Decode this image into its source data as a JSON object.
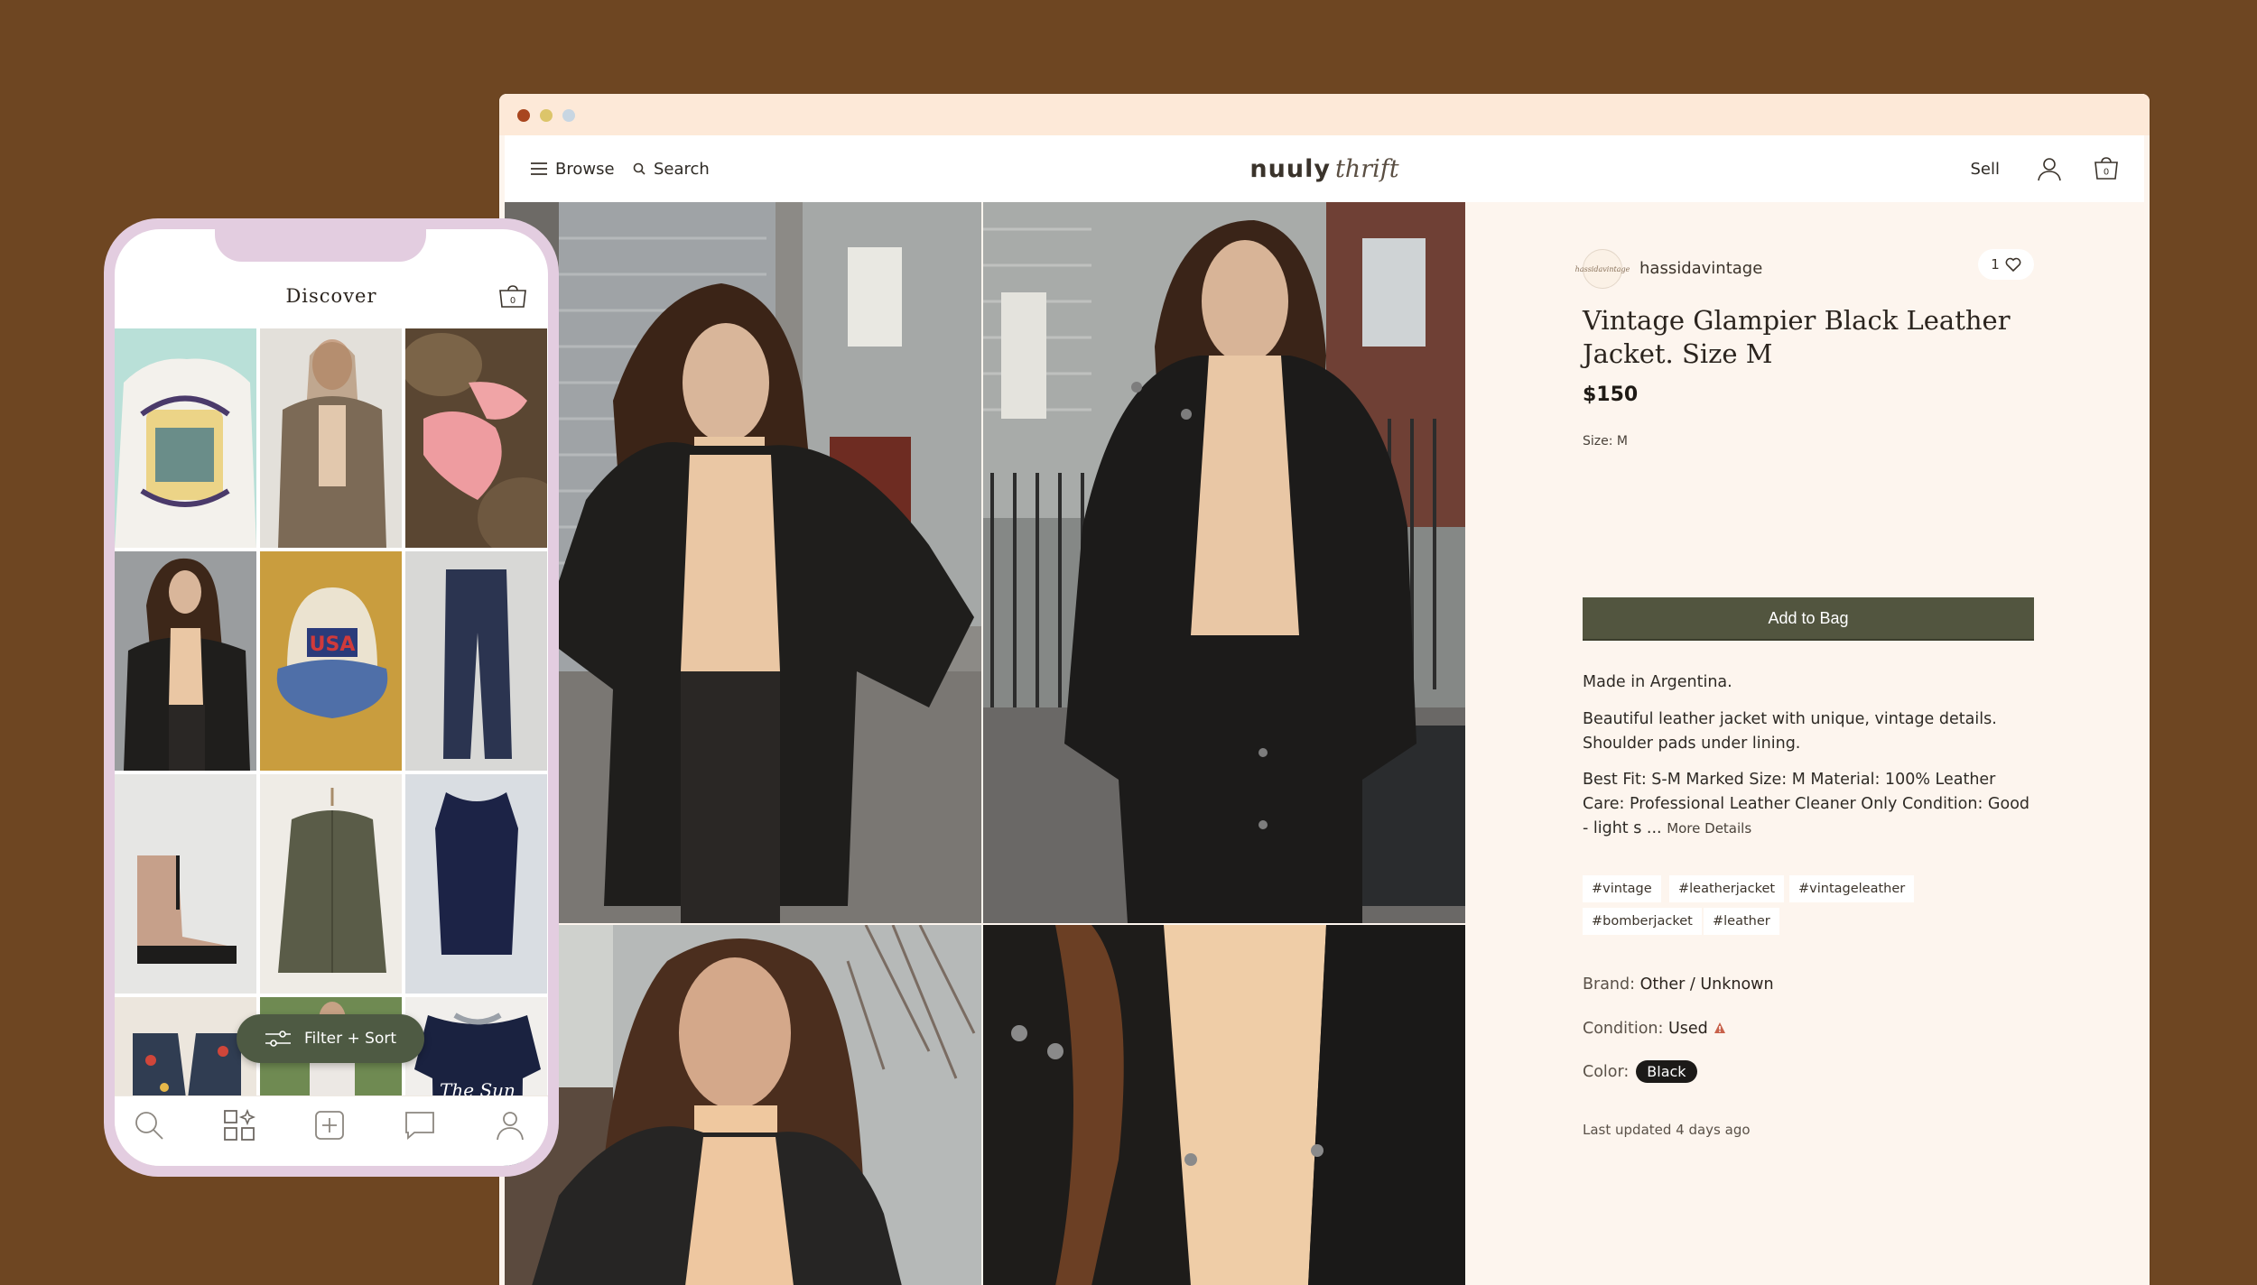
{
  "colors": {
    "background": "#6e4622",
    "browser_titlebar": "#fde9d8",
    "panel_bg": "#fdf5ee",
    "add_button": "#52553f",
    "phone_frame": "#e3cde0",
    "filter_button": "#4e5a43"
  },
  "desktop": {
    "nav": {
      "browse_label": "Browse",
      "search_label": "Search",
      "logo_bold": "nuuly",
      "logo_italic": "thrift",
      "sell_label": "Sell",
      "cart_count": "0",
      "icons": [
        "menu-icon",
        "search-icon",
        "user-icon",
        "bag-icon"
      ]
    },
    "product": {
      "seller": "hassidavintage",
      "seller_avatar_text": "hassidavintage",
      "likes": "1",
      "title": "Vintage Glampier Black Leather Jacket. Size M",
      "price": "$150",
      "size_label": "Size:",
      "size_value": "M",
      "add_to_bag": "Add to Bag",
      "description_1": "Made in Argentina.",
      "description_2": "Beautiful leather jacket with unique, vintage details. Shoulder pads under lining.",
      "description_3": "Best Fit: S-M Marked Size: M Material: 100% Leather Care: Professional Leather Cleaner Only Condition: Good - light s ...",
      "more_details": "More Details",
      "tags": [
        "#vintage",
        "#leatherjacket",
        "#vintageleather",
        "#bomberjacket",
        "#leather"
      ],
      "brand_label": "Brand:",
      "brand_value": "Other / Unknown",
      "condition_label": "Condition:",
      "condition_value": "Used",
      "color_label": "Color:",
      "color_value": "Black",
      "last_updated": "Last updated 4 days ago"
    }
  },
  "phone": {
    "title": "Discover",
    "cart_count": "0",
    "filter_label": "Filter + Sort",
    "tabs": [
      "search-icon",
      "discover-icon",
      "add-icon",
      "messages-icon",
      "profile-icon"
    ]
  }
}
